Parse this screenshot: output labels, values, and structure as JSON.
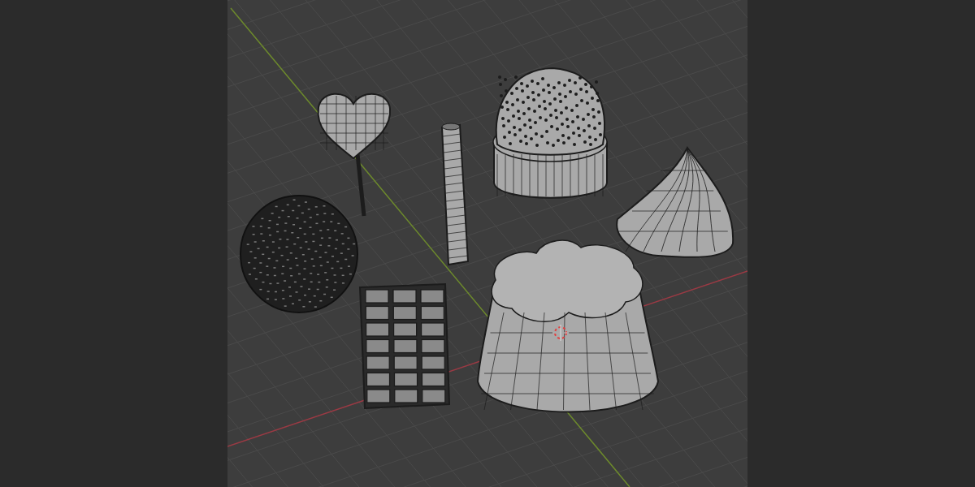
{
  "viewport": {
    "overlays": {
      "grid": true,
      "axes": true,
      "cursor_3d": true
    },
    "objects": [
      {
        "kind": "lollipop"
      },
      {
        "kind": "wafer"
      },
      {
        "kind": "cupcake"
      },
      {
        "kind": "meringue"
      },
      {
        "kind": "sprinkle_ball"
      },
      {
        "kind": "chocolate_bar"
      },
      {
        "kind": "jelly"
      }
    ]
  }
}
